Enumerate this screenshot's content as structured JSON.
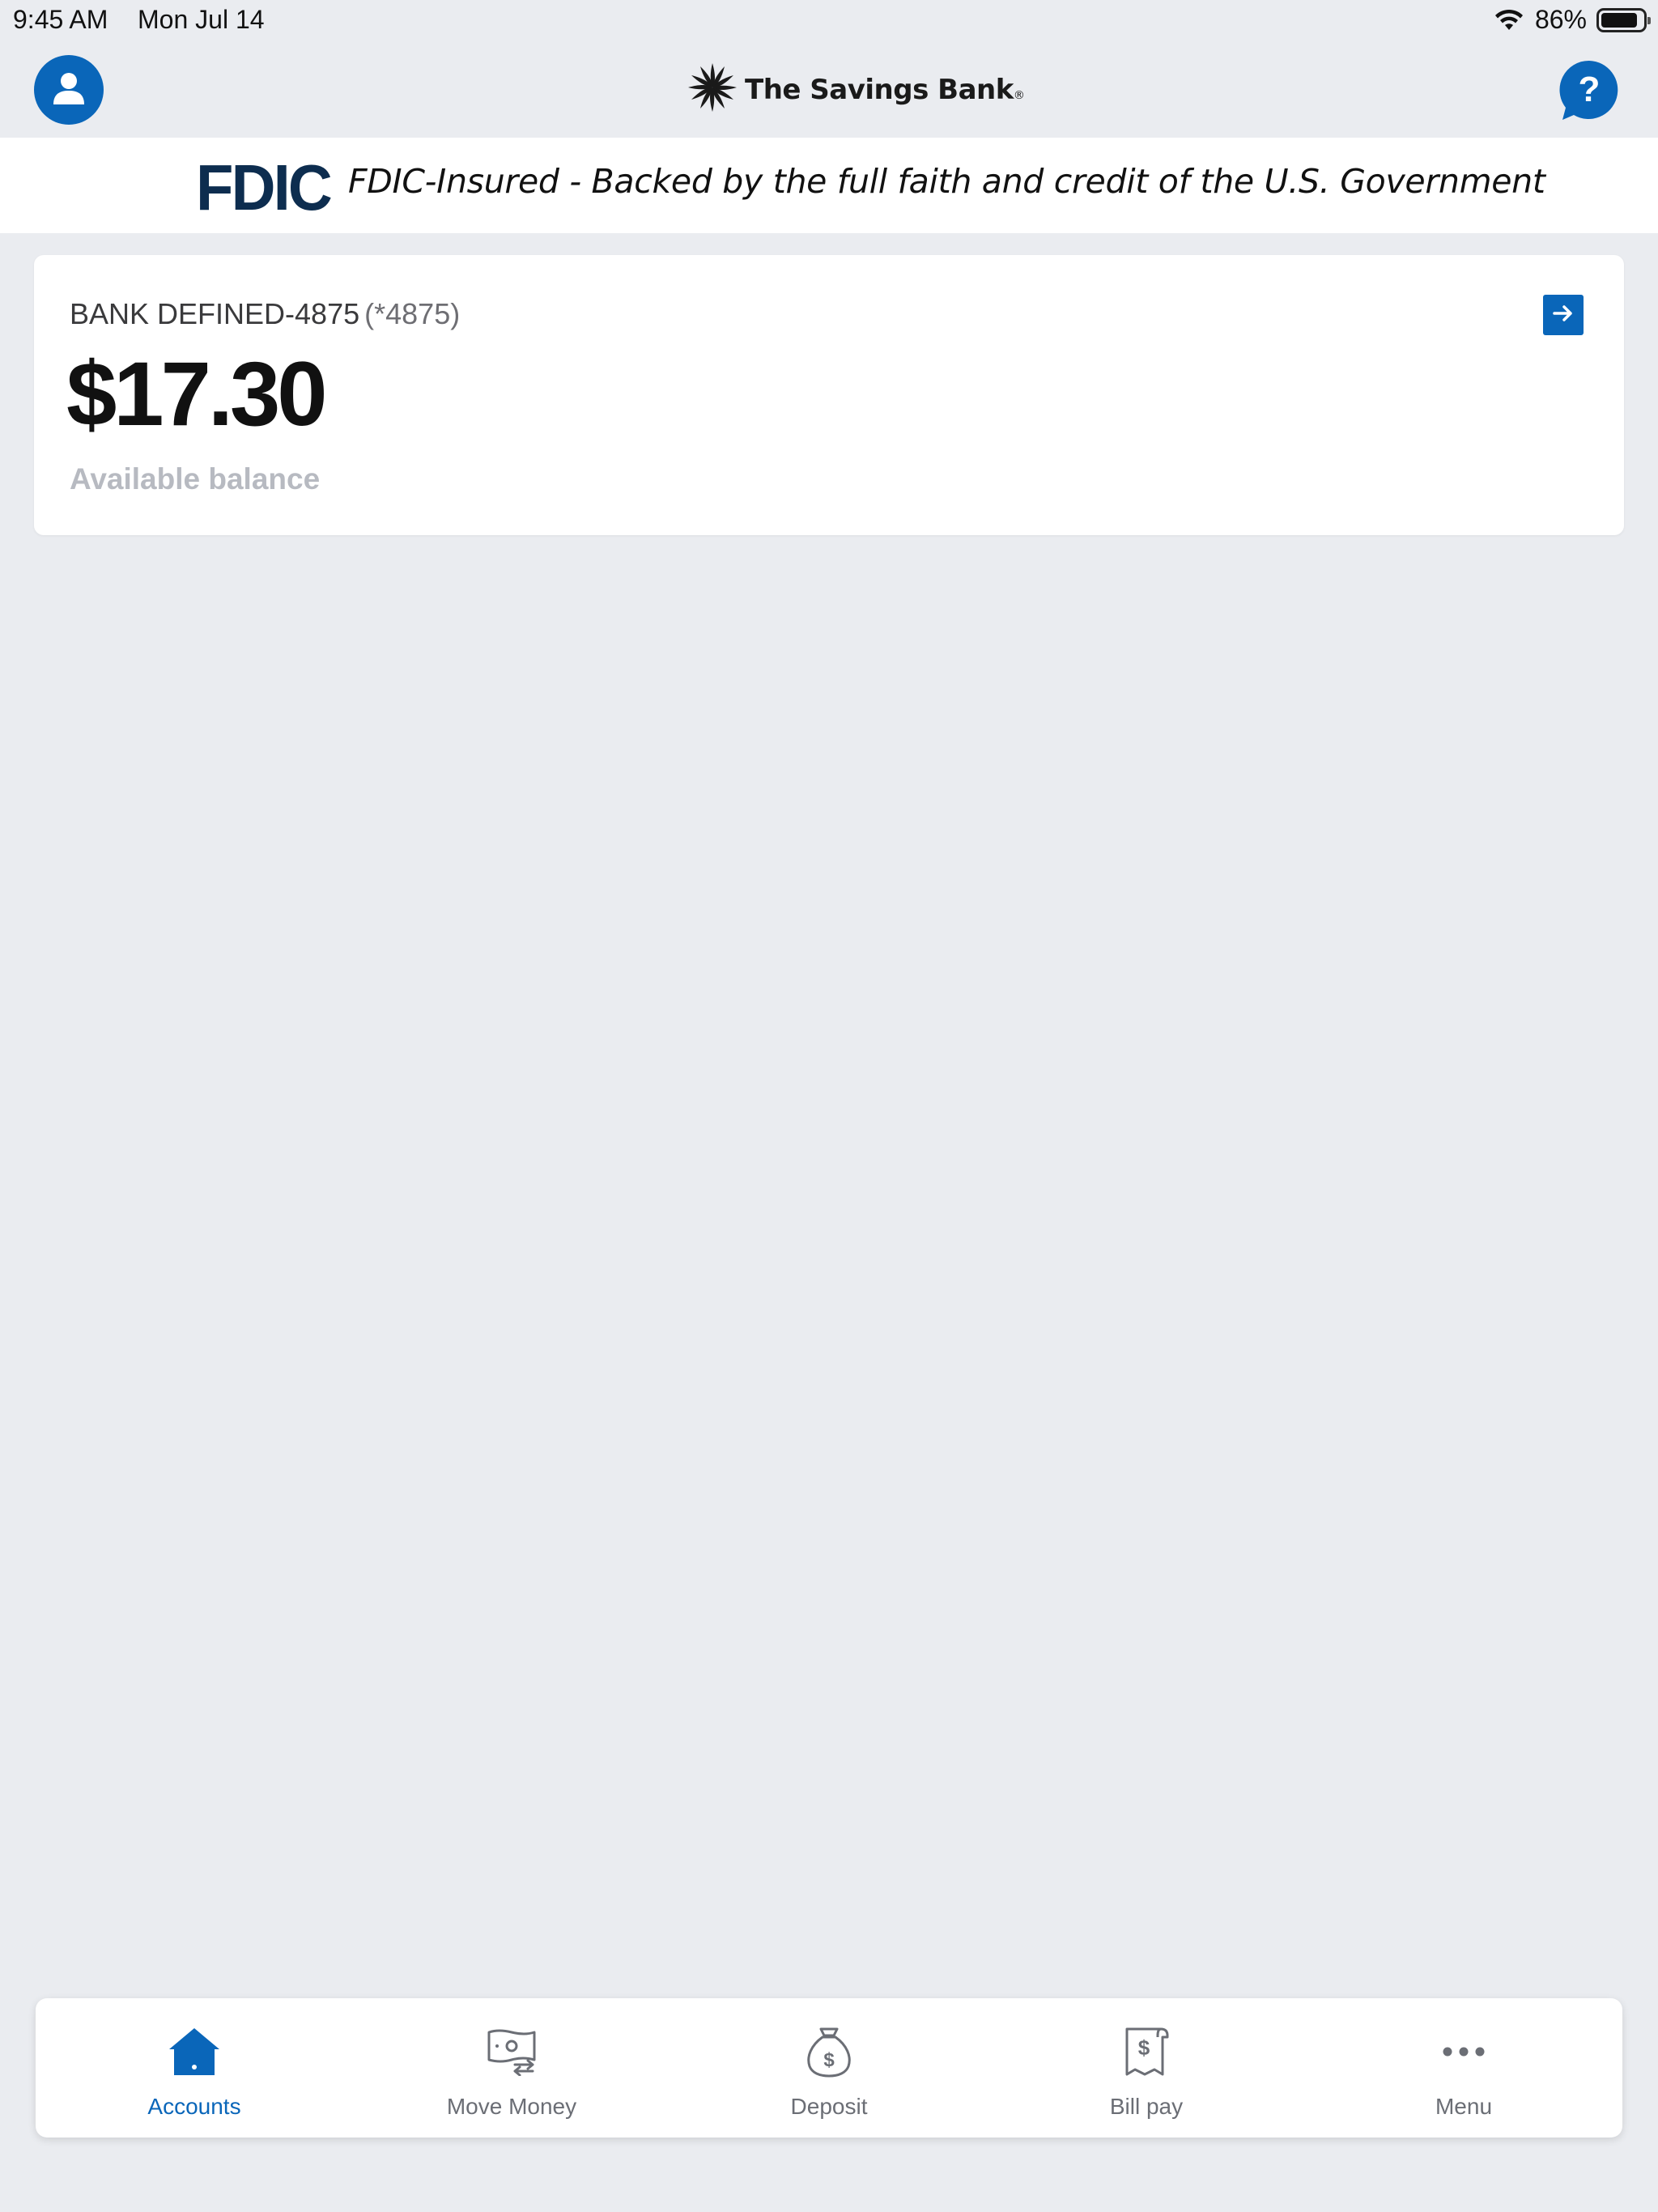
{
  "status_bar": {
    "time": "9:45 AM",
    "date": "Mon Jul 14",
    "battery": "86%"
  },
  "header": {
    "brand_name": "The Savings Bank",
    "brand_mark": "®",
    "profile_icon": "person-icon",
    "help_icon": "help-chat-icon"
  },
  "fdic": {
    "logo": "FDIC",
    "text": "FDIC-Insured - Backed by the full faith and credit of the U.S. Government"
  },
  "account": {
    "name": "BANK DEFINED-4875",
    "mask": "(*4875)",
    "balance": "$17.30",
    "balance_label": "Available balance"
  },
  "tabs": [
    {
      "label": "Accounts",
      "icon": "home-icon",
      "active": true
    },
    {
      "label": "Move Money",
      "icon": "transfer-money-icon",
      "active": false
    },
    {
      "label": "Deposit",
      "icon": "money-bag-icon",
      "active": false
    },
    {
      "label": "Bill pay",
      "icon": "bill-icon",
      "active": false
    },
    {
      "label": "Menu",
      "icon": "more-dots-icon",
      "active": false
    }
  ],
  "colors": {
    "accent": "#0a66b9",
    "background": "#eaecf0",
    "fdic_navy": "#0d2d4f"
  }
}
